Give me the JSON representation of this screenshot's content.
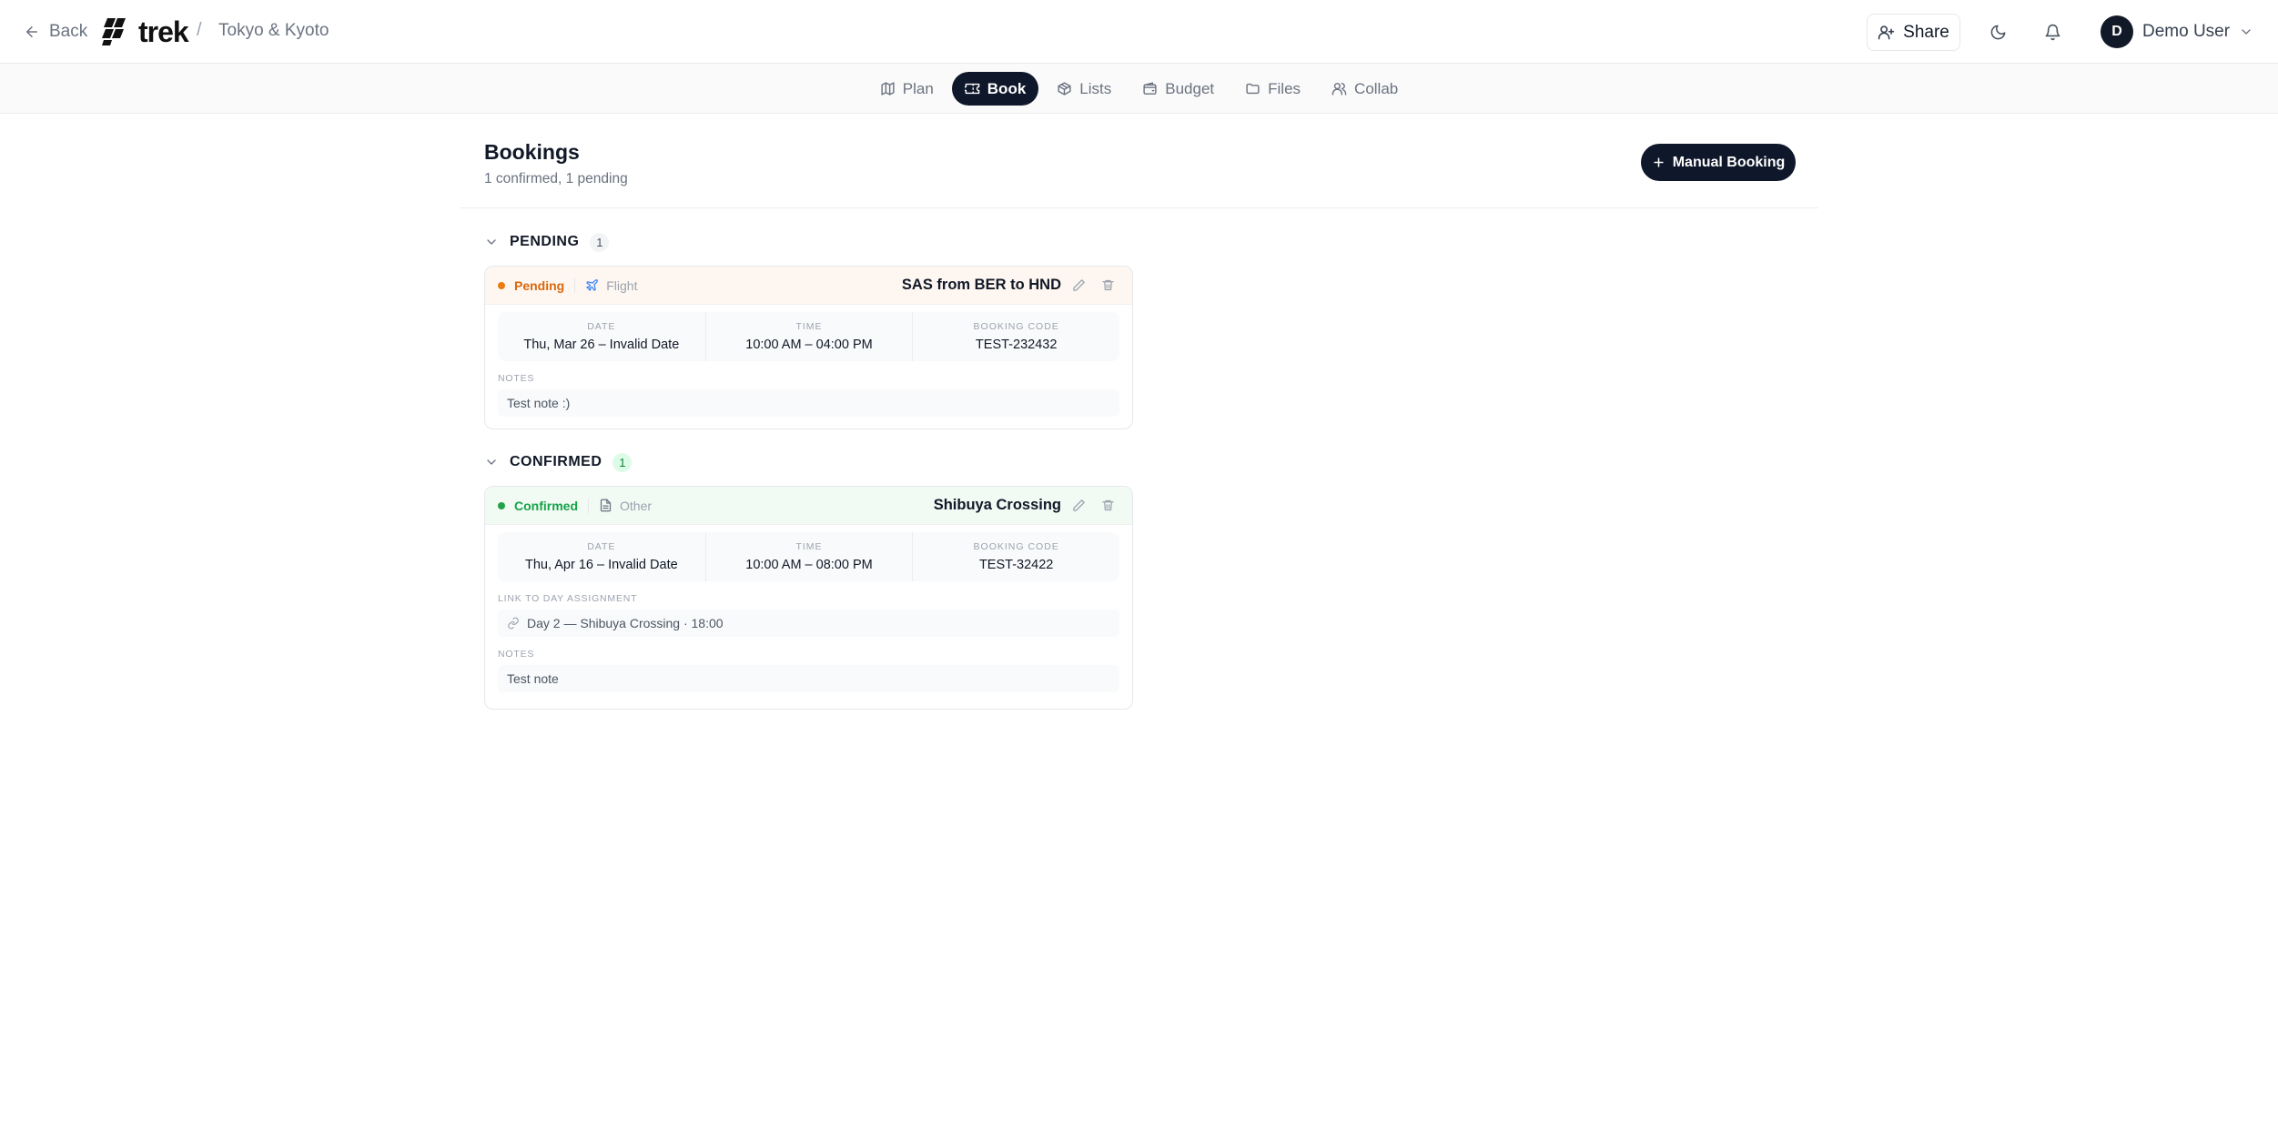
{
  "header": {
    "back_label": "Back",
    "logo_text": "trek",
    "breadcrumb_sep": "/",
    "trip_name": "Tokyo & Kyoto",
    "share_label": "Share",
    "user_initial": "D",
    "user_name": "Demo User"
  },
  "tabs": [
    {
      "label": "Plan",
      "icon": "map-icon",
      "active": false
    },
    {
      "label": "Book",
      "icon": "ticket-icon",
      "active": true
    },
    {
      "label": "Lists",
      "icon": "package-icon",
      "active": false
    },
    {
      "label": "Budget",
      "icon": "wallet-icon",
      "active": false
    },
    {
      "label": "Files",
      "icon": "folder-icon",
      "active": false
    },
    {
      "label": "Collab",
      "icon": "users-icon",
      "active": false
    }
  ],
  "page": {
    "title": "Bookings",
    "subtitle": "1 confirmed, 1 pending",
    "manual_booking_label": "Manual Booking"
  },
  "sections": {
    "pending": {
      "label": "PENDING",
      "count": "1",
      "booking": {
        "status": "Pending",
        "status_color": "#ea7b12",
        "type": "Flight",
        "type_icon": "plane-icon",
        "title": "SAS from BER to HND",
        "date_label": "DATE",
        "date": "Thu, Mar 26 – Invalid Date",
        "time_label": "TIME",
        "time": "10:00 AM – 04:00 PM",
        "code_label": "BOOKING CODE",
        "code": "TEST-232432",
        "notes_label": "NOTES",
        "notes": "Test note :)"
      }
    },
    "confirmed": {
      "label": "CONFIRMED",
      "count": "1",
      "booking": {
        "status": "Confirmed",
        "status_color": "#22a34a",
        "type": "Other",
        "type_icon": "file-icon",
        "title": "Shibuya Crossing",
        "date_label": "DATE",
        "date": "Thu, Apr 16 – Invalid Date",
        "time_label": "TIME",
        "time": "10:00 AM – 08:00 PM",
        "code_label": "BOOKING CODE",
        "code": "TEST-32422",
        "link_label": "LINK TO DAY ASSIGNMENT",
        "link_value": "Day 2 — Shibuya Crossing · 18:00",
        "notes_label": "NOTES",
        "notes": "Test note"
      }
    }
  }
}
